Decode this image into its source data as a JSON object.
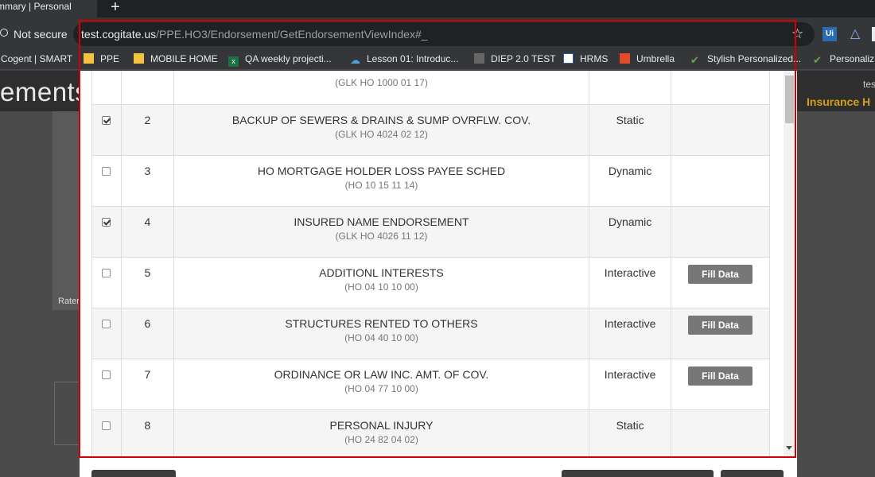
{
  "browser": {
    "tab_title": "mmary | Personal",
    "new_tab_symbol": "+",
    "security_label": "Not secure",
    "url_host": "test.cogitate.us",
    "url_path": "/PPE.HO3/Endorsement/GetEndorsementViewIndex#_",
    "ext1_label": "Ui"
  },
  "bookmarks": [
    {
      "label": "Cogent | SMART",
      "icon": "none"
    },
    {
      "label": "PPE",
      "icon": "folder-icon"
    },
    {
      "label": "MOBILE HOME",
      "icon": "folder-icon"
    },
    {
      "label": "QA weekly projecti...",
      "icon": "excel-icon"
    },
    {
      "label": "Lesson 01: Introduc...",
      "icon": "cloud-icon"
    },
    {
      "label": "DIEP 2.0 TEST",
      "icon": "diep-icon"
    },
    {
      "label": "HRMS",
      "icon": "hrms-icon"
    },
    {
      "label": "Umbrella",
      "icon": "umbrella-icon"
    },
    {
      "label": "Stylish Personalized...",
      "icon": "leaf-icon"
    },
    {
      "label": "Personaliz",
      "icon": "leaf-icon"
    }
  ],
  "page": {
    "heading": "ements",
    "insurance_label": "Insurance H",
    "user_label": "tes",
    "rater_label": "Rater"
  },
  "endorsements": {
    "first_row_code": "(GLK HO 1000 01 17)",
    "rows": [
      {
        "num": "2",
        "checked": true,
        "name": "BACKUP OF SEWERS & DRAINS & SUMP OVRFLW. COV.",
        "code": "(GLK HO 4024 02 12)",
        "type": "Static",
        "action": ""
      },
      {
        "num": "3",
        "checked": false,
        "name": "HO MORTGAGE HOLDER LOSS PAYEE SCHED",
        "code": "(HO 10 15 11 14)",
        "type": "Dynamic",
        "action": ""
      },
      {
        "num": "4",
        "checked": true,
        "name": "INSURED NAME ENDORSEMENT",
        "code": "(GLK HO 4026 11 12)",
        "type": "Dynamic",
        "action": ""
      },
      {
        "num": "5",
        "checked": false,
        "name": "ADDITIONL INTERESTS",
        "code": "(HO 04 10 10 00)",
        "type": "Interactive",
        "action": "Fill Data"
      },
      {
        "num": "6",
        "checked": false,
        "name": "STRUCTURES RENTED TO OTHERS",
        "code": "(HO 04 40 10 00)",
        "type": "Interactive",
        "action": "Fill Data"
      },
      {
        "num": "7",
        "checked": false,
        "name": "ORDINANCE OR LAW INC. AMT. OF COV.",
        "code": "(HO 04 77 10 00)",
        "type": "Interactive",
        "action": "Fill Data"
      },
      {
        "num": "8",
        "checked": false,
        "name": "PERSONAL INJURY",
        "code": "(HO 24 82 04 02)",
        "type": "Static",
        "action": ""
      }
    ]
  },
  "colors": {
    "highlight": "#d40000",
    "fill_button": "#777777"
  }
}
